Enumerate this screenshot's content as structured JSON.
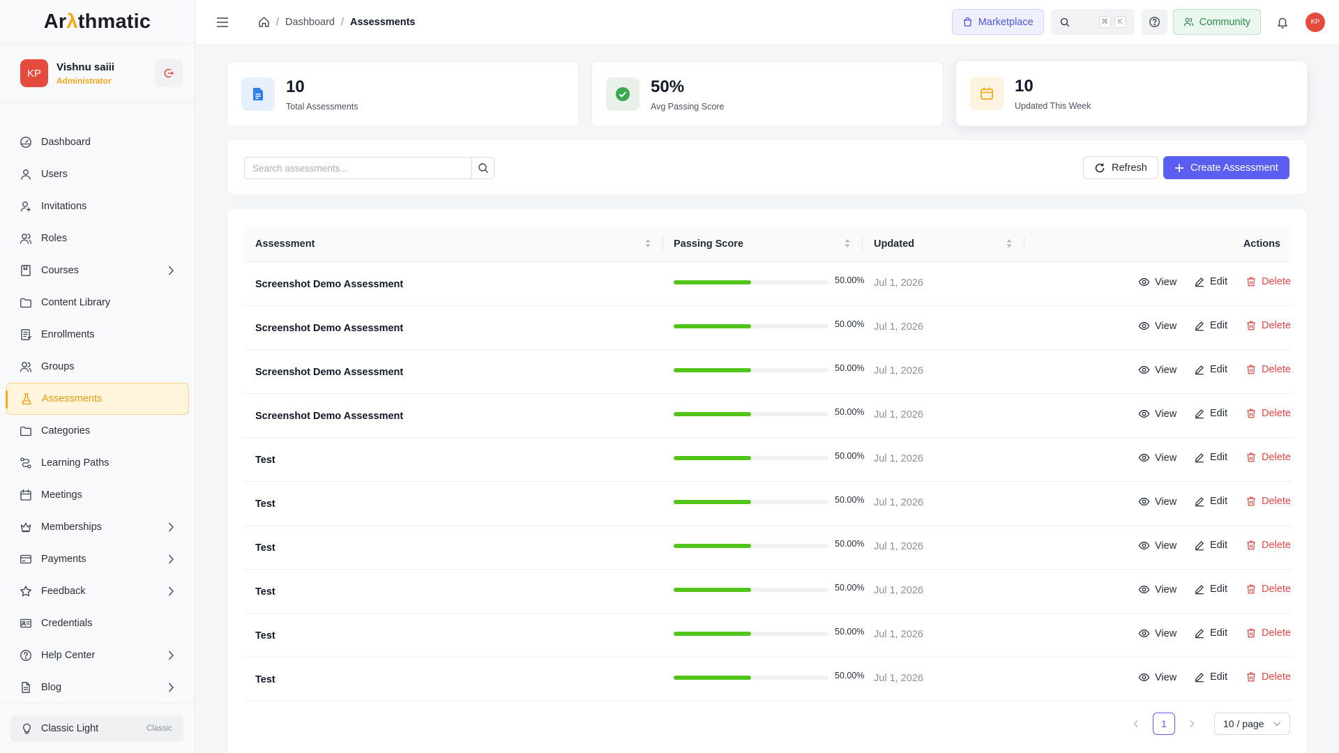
{
  "app": {
    "logo_prefix": "Ar",
    "logo_accent": "λ",
    "logo_suffix": "thmatic",
    "accent_color": "#f4a81d",
    "primary_color": "#5b5ff1"
  },
  "user": {
    "initials": "KP",
    "name": "Vishnu saiii",
    "role": "Administrator"
  },
  "sidebar": {
    "items": [
      {
        "label": "Dashboard",
        "icon": "dashboard-icon"
      },
      {
        "label": "Users",
        "icon": "user-icon"
      },
      {
        "label": "Invitations",
        "icon": "user-plus-icon"
      },
      {
        "label": "Roles",
        "icon": "roles-icon"
      },
      {
        "label": "Courses",
        "icon": "book-icon",
        "expandable": true
      },
      {
        "label": "Content Library",
        "icon": "folder-icon"
      },
      {
        "label": "Enrollments",
        "icon": "enrollment-icon"
      },
      {
        "label": "Groups",
        "icon": "group-icon"
      },
      {
        "label": "Assessments",
        "icon": "flask-icon",
        "active": true
      },
      {
        "label": "Categories",
        "icon": "folder-icon"
      },
      {
        "label": "Learning Paths",
        "icon": "path-icon"
      },
      {
        "label": "Meetings",
        "icon": "calendar-icon"
      },
      {
        "label": "Memberships",
        "icon": "crown-icon",
        "expandable": true
      },
      {
        "label": "Payments",
        "icon": "card-icon",
        "expandable": true
      },
      {
        "label": "Feedback",
        "icon": "star-icon",
        "expandable": true
      },
      {
        "label": "Credentials",
        "icon": "id-card-icon"
      },
      {
        "label": "Help Center",
        "icon": "help-icon",
        "expandable": true
      },
      {
        "label": "Blog",
        "icon": "document-icon",
        "expandable": true
      }
    ],
    "theme": {
      "label": "Classic Light",
      "tag": "Classic"
    }
  },
  "header": {
    "breadcrumb": [
      "Dashboard",
      "Assessments"
    ],
    "marketplace_label": "Marketplace",
    "search_shortcut": [
      "⌘",
      "K"
    ],
    "community_label": "Community",
    "avatar_initials": "KP"
  },
  "stats": [
    {
      "value": "10",
      "label": "Total Assessments",
      "icon": "document-icon",
      "color": "#2f7fe8",
      "bg": "#e6f0fc"
    },
    {
      "value": "50%",
      "label": "Avg Passing Score",
      "icon": "check-circle-icon",
      "color": "#3aa84f",
      "bg": "#eaf0ea"
    },
    {
      "value": "10",
      "label": "Updated This Week",
      "icon": "calendar-icon",
      "color": "#f4a81d",
      "bg": "#fdf3e1"
    }
  ],
  "toolbar": {
    "search_placeholder": "Search assessments...",
    "refresh_label": "Refresh",
    "create_label": "Create Assessment"
  },
  "table": {
    "columns": [
      "Assessment",
      "Passing Score",
      "Updated",
      "Actions"
    ],
    "action_labels": {
      "view": "View",
      "edit": "Edit",
      "delete": "Delete"
    },
    "rows": [
      {
        "name": "Screenshot Demo Assessment",
        "score": 50,
        "score_label": "50.00%",
        "updated": "Jul 1, 2026"
      },
      {
        "name": "Screenshot Demo Assessment",
        "score": 50,
        "score_label": "50.00%",
        "updated": "Jul 1, 2026"
      },
      {
        "name": "Screenshot Demo Assessment",
        "score": 50,
        "score_label": "50.00%",
        "updated": "Jul 1, 2026"
      },
      {
        "name": "Screenshot Demo Assessment",
        "score": 50,
        "score_label": "50.00%",
        "updated": "Jul 1, 2026"
      },
      {
        "name": "Test",
        "score": 50,
        "score_label": "50.00%",
        "updated": "Jul 1, 2026"
      },
      {
        "name": "Test",
        "score": 50,
        "score_label": "50.00%",
        "updated": "Jul 1, 2026"
      },
      {
        "name": "Test",
        "score": 50,
        "score_label": "50.00%",
        "updated": "Jul 1, 2026"
      },
      {
        "name": "Test",
        "score": 50,
        "score_label": "50.00%",
        "updated": "Jul 1, 2026"
      },
      {
        "name": "Test",
        "score": 50,
        "score_label": "50.00%",
        "updated": "Jul 1, 2026"
      },
      {
        "name": "Test",
        "score": 50,
        "score_label": "50.00%",
        "updated": "Jul 1, 2026"
      }
    ]
  },
  "pagination": {
    "current_page": "1",
    "page_size": "10 / page"
  }
}
